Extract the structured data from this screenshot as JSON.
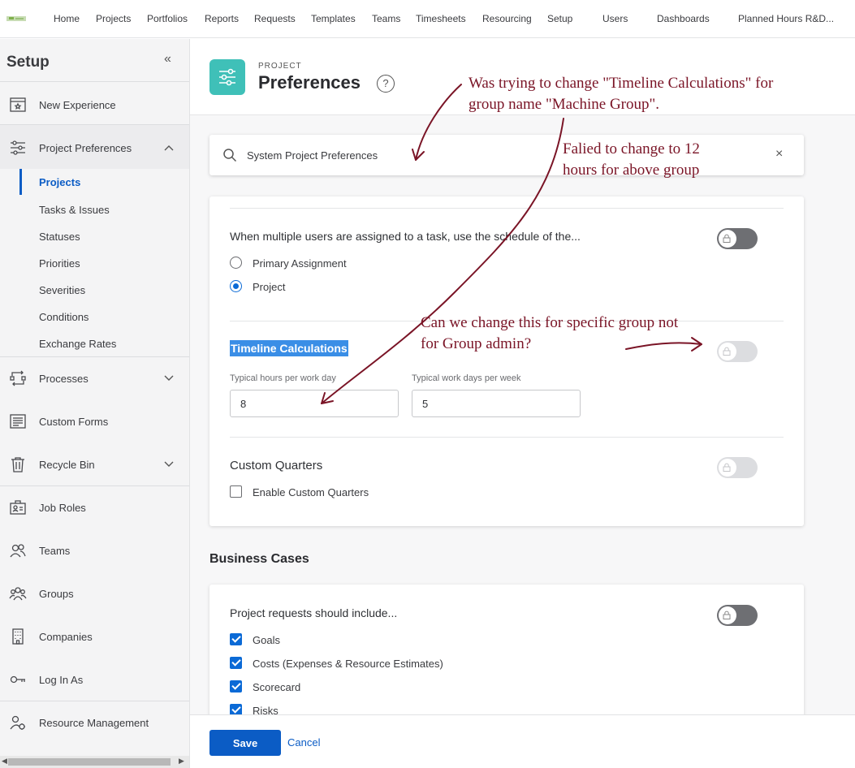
{
  "nav": {
    "items": [
      "Home",
      "Projects",
      "Portfolios",
      "Reports",
      "Requests",
      "Templates",
      "Teams",
      "Timesheets",
      "Resourcing",
      "Setup",
      "Users",
      "Dashboards",
      "Planned Hours R&D..."
    ]
  },
  "sidebar": {
    "title": "Setup",
    "collapse_icon": "«",
    "new_experience": "New Experience",
    "project_preferences": "Project Preferences",
    "sub_items": [
      "Projects",
      "Tasks & Issues",
      "Statuses",
      "Priorities",
      "Severities",
      "Conditions",
      "Exchange Rates"
    ],
    "active_sub": "Projects",
    "processes": "Processes",
    "custom_forms": "Custom Forms",
    "recycle_bin": "Recycle Bin",
    "job_roles": "Job Roles",
    "teams": "Teams",
    "groups": "Groups",
    "companies": "Companies",
    "log_in_as": "Log In As",
    "resource_management": "Resource Management"
  },
  "header": {
    "eyebrow": "PROJECT",
    "title": "Preferences",
    "help": "?"
  },
  "search": {
    "value": "System Project Preferences",
    "clear": "×"
  },
  "schedule": {
    "question": "When multiple users are assigned to a task, use the schedule of the...",
    "options": [
      "Primary Assignment",
      "Project"
    ],
    "selected": "Project"
  },
  "timeline": {
    "title": "Timeline Calculations",
    "hours_label": "Typical hours per work day",
    "hours_value": "8",
    "days_label": "Typical work days per week",
    "days_value": "5"
  },
  "quarters": {
    "title": "Custom Quarters",
    "checkbox_label": "Enable Custom Quarters",
    "checked": false
  },
  "business": {
    "section_title": "Business Cases",
    "question": "Project requests should include...",
    "items": [
      "Goals",
      "Costs (Expenses & Resource Estimates)",
      "Scorecard",
      "Risks"
    ]
  },
  "footer": {
    "save": "Save",
    "cancel": "Cancel"
  },
  "annotations": {
    "a1_line1": "Was trying to change \"Timeline Calculations\" for",
    "a1_line2": "group name \"Machine Group\".",
    "a2_line1": "Falied to change to 12",
    "a2_line2": "hours for above group",
    "a3_line1": "Can we change this for specific group not",
    "a3_line2": "for Group admin?"
  },
  "colors": {
    "accent": "#0b5cc5",
    "page_icon": "#3fc0b8",
    "annotation": "#7a1426",
    "highlight": "#3a8ee6"
  }
}
